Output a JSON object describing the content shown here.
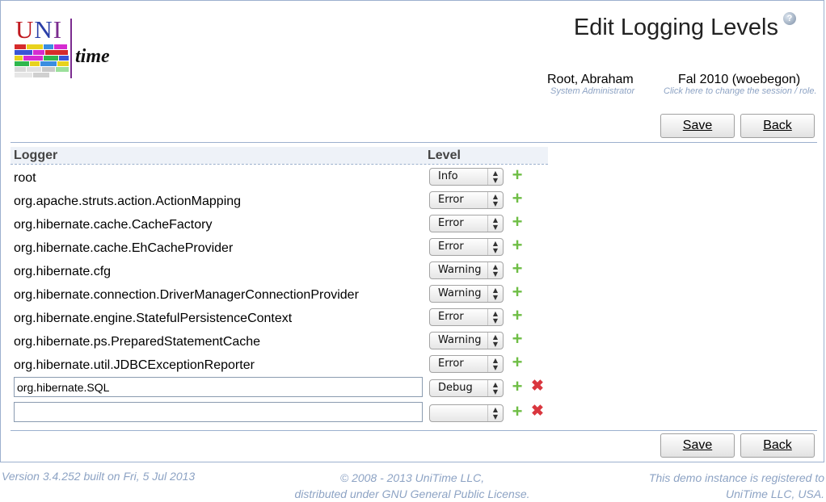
{
  "header": {
    "title": "Edit Logging Levels",
    "help_glyph": "?",
    "logo": {
      "uni_u": "U",
      "uni_n": "N",
      "uni_i": "I",
      "time": "time"
    },
    "user": {
      "name": "Root, Abraham",
      "role": "System Administrator"
    },
    "session": {
      "name": "Fal 2010 (woebegon)",
      "hint": "Click here to change the session / role."
    }
  },
  "buttons": {
    "save": "Save",
    "back": "Back"
  },
  "table": {
    "headers": {
      "logger": "Logger",
      "level": "Level"
    },
    "rows": [
      {
        "logger": "root",
        "level": "Info"
      },
      {
        "logger": "org.apache.struts.action.ActionMapping",
        "level": "Error"
      },
      {
        "logger": "org.hibernate.cache.CacheFactory",
        "level": "Error"
      },
      {
        "logger": "org.hibernate.cache.EhCacheProvider",
        "level": "Error"
      },
      {
        "logger": "org.hibernate.cfg",
        "level": "Warning"
      },
      {
        "logger": "org.hibernate.connection.DriverManagerConnectionProvider",
        "level": "Warning"
      },
      {
        "logger": "org.hibernate.engine.StatefulPersistenceContext",
        "level": "Error"
      },
      {
        "logger": "org.hibernate.ps.PreparedStatementCache",
        "level": "Warning"
      },
      {
        "logger": "org.hibernate.util.JDBCExceptionReporter",
        "level": "Error"
      }
    ],
    "editable_rows": [
      {
        "logger": "org.hibernate.SQL",
        "level": "Debug"
      },
      {
        "logger": "",
        "level": ""
      }
    ],
    "icons": {
      "add": "add-icon",
      "delete": "delete-icon"
    }
  },
  "footer": {
    "version": "Version 3.4.252 built on Fri, 5 Jul 2013",
    "copyright_line1": "© 2008 - 2013 UniTime LLC,",
    "copyright_line2": "distributed under GNU General Public License.",
    "registration_line1": "This demo instance is registered to",
    "registration_line2": "UniTime LLC, USA."
  },
  "colors": {
    "accent": "#9cb0ce",
    "hint": "#8da3c4",
    "add": "#6fbe46",
    "delete": "#d9363e"
  }
}
